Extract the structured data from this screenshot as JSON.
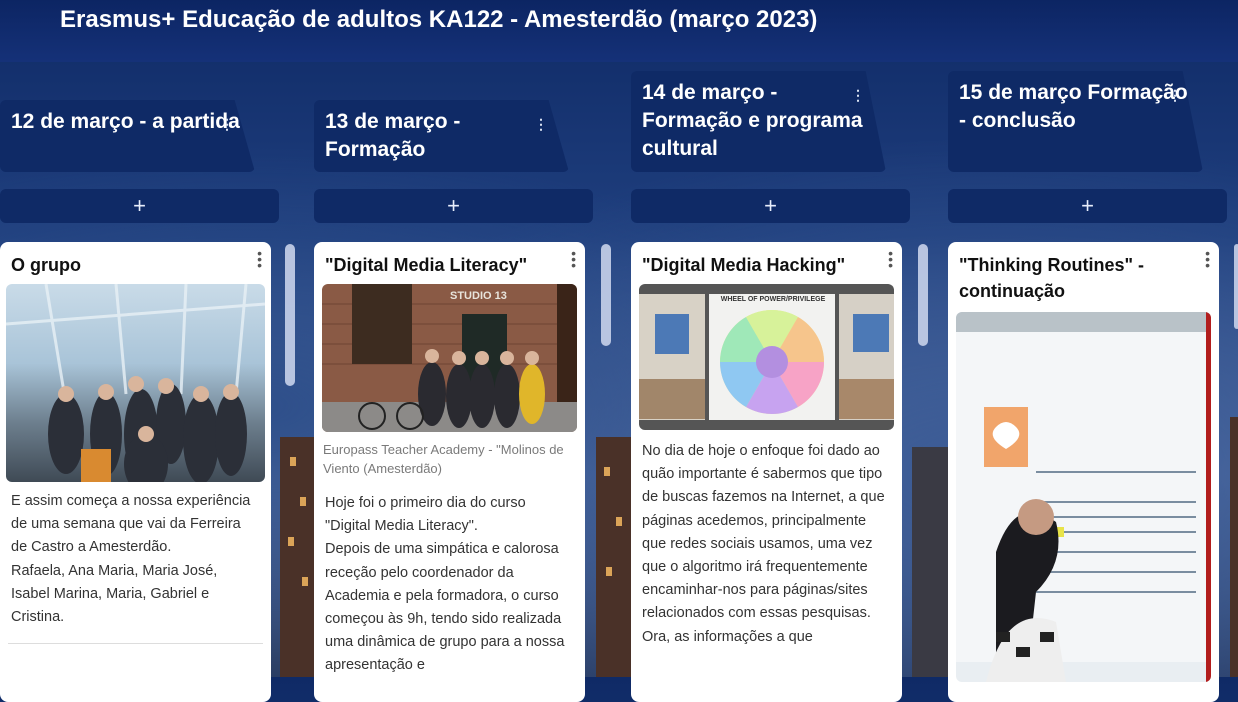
{
  "header": {
    "title": "Erasmus+ Educação de adultos KA122 - Amesterdão (março 2023)"
  },
  "columns": [
    {
      "title": "12 de março - a partida",
      "add_label": "+",
      "card": {
        "title": "O grupo",
        "body": "E assim começa a nossa experiência de uma semana que vai da Ferreira de Castro a Amesterdão.\nRafaela, Ana Maria, Maria José, Isabel Marina, Maria, Gabriel e Cristina."
      }
    },
    {
      "title": "13 de março - Formação",
      "add_label": "+",
      "card": {
        "title": "\"Digital Media Literacy\"",
        "caption": "Europass Teacher Academy - \"Molinos de Viento (Amesterdão)",
        "photo_sign": "STUDIO 13",
        "body": "Hoje foi o primeiro dia do curso \"Digital Media Literacy\".\nDepois de uma simpática  e calorosa receção pelo coordenador da Academia e pela formadora, o curso começou às 9h, tendo sido realizada uma dinâmica de grupo para a nossa apresentação e"
      }
    },
    {
      "title": "14 de março - Formação e programa cultural",
      "add_label": "+",
      "card": {
        "title": "\"Digital Media Hacking\"",
        "photo_poster": "WHEEL OF POWER/PRIVILEGE",
        "body": "No dia de hoje o enfoque foi dado ao quão importante é sabermos que tipo de buscas fazemos na Internet, a que páginas acedemos, principalmente que redes sociais usamos, uma vez que o algoritmo irá frequentemente encaminhar-nos para páginas/sites relacionados com essas pesquisas. Ora, as informações a que"
      }
    },
    {
      "title": "15 de março Formação - conclusão",
      "add_label": "+",
      "card": {
        "title": "\"Thinking Routines\" - continuação"
      }
    }
  ],
  "icons": {
    "kebab": "⋮",
    "plus": "+"
  }
}
